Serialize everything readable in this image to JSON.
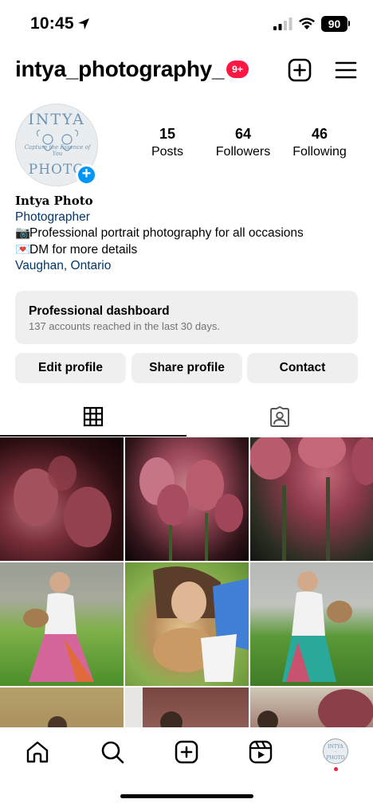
{
  "status_bar": {
    "time": "10:45",
    "battery": "90"
  },
  "header": {
    "username": "intya_photography_",
    "notification_badge": "9+"
  },
  "profile": {
    "avatar_top_text": "INTYA",
    "avatar_tagline": "Capture the Essence of You",
    "avatar_bottom_text": "PHOTO",
    "stats": [
      {
        "value": "15",
        "label": "Posts"
      },
      {
        "value": "64",
        "label": "Followers"
      },
      {
        "value": "46",
        "label": "Following"
      }
    ],
    "bio": {
      "name": "Intya Photo",
      "category": "Photographer",
      "line1_emoji": "📷",
      "line1": "Professional portrait photography for all occasions",
      "line2_emoji": "💌",
      "line2": "DM for more details",
      "location": "Vaughan, Ontario"
    }
  },
  "dashboard": {
    "title": "Professional dashboard",
    "subtitle": "137 accounts reached in the last 30 days."
  },
  "actions": {
    "edit": "Edit profile",
    "share": "Share profile",
    "contact": "Contact"
  },
  "tabs": {
    "active": "grid"
  },
  "colors": {
    "accent_blue": "#0095f6",
    "badge_red": "#ff1744",
    "link_blue": "#00376b",
    "button_gray": "#efefef"
  },
  "icons": {
    "create": "plus-square-icon",
    "menu": "hamburger-icon",
    "grid_tab": "grid-icon",
    "tagged_tab": "person-tag-icon",
    "nav": [
      "home-icon",
      "search-icon",
      "create-icon",
      "reels-icon",
      "profile-avatar"
    ]
  }
}
